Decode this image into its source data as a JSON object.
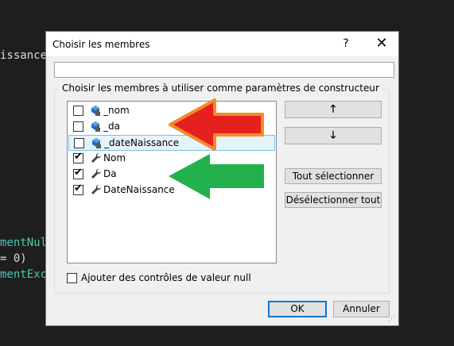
{
  "background_code": {
    "line1": "issance",
    "line2": "mentNul",
    "line3": "= 0)",
    "line4": "mentExc"
  },
  "dialog": {
    "title": "Choisir les membres",
    "help_label": "?",
    "close_label": "✕",
    "search_value": "",
    "group_label": "Choisir les membres à utiliser comme paramètres de constructeur",
    "members": [
      {
        "label": "_nom",
        "checked": false,
        "kind": "field",
        "selected": false
      },
      {
        "label": "_da",
        "checked": false,
        "kind": "field",
        "selected": false
      },
      {
        "label": "_dateNaissance",
        "checked": false,
        "kind": "field",
        "selected": true
      },
      {
        "label": "Nom",
        "checked": true,
        "kind": "property",
        "selected": false
      },
      {
        "label": "Da",
        "checked": true,
        "kind": "property",
        "selected": false
      },
      {
        "label": "DateNaissance",
        "checked": true,
        "kind": "property",
        "selected": false
      }
    ],
    "move_up_label": "🡑",
    "move_down_label": "🡓",
    "select_all_label": "Tout sélectionner",
    "deselect_all_label": "Désélectionner tout",
    "null_check_label": "Ajouter des contrôles de valeur null",
    "null_check_checked": false,
    "ok_label": "OK",
    "cancel_label": "Annuler"
  },
  "colors": {
    "red_arrow": "#e5201e",
    "red_arrow_outline": "#f08c2a",
    "green_arrow": "#22b14c"
  }
}
